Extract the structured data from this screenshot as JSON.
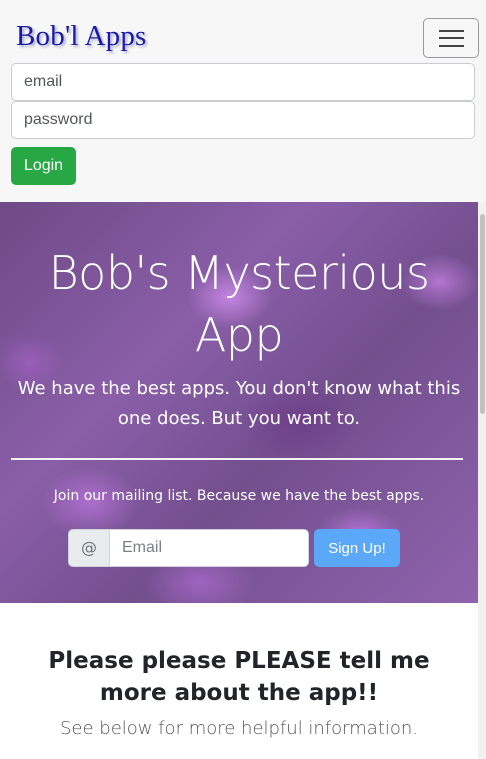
{
  "navbar": {
    "brand": "Bob'l Apps",
    "toggler_icon": "hamburger-menu-icon",
    "email_placeholder": "email",
    "password_placeholder": "password",
    "login_label": "Login",
    "login_color": "#28a745"
  },
  "hero": {
    "title": "Bob's Mysterious App",
    "lead": "We have the best apps. You don't know what this one does. But you want to.",
    "mailing_text": "Join our mailing list. Because we have the best apps.",
    "at_symbol": "@",
    "email_placeholder": "Email",
    "signup_label": "Sign Up!",
    "signup_color": "#5aa8f7",
    "background_color": "#7a5296"
  },
  "info": {
    "title": "Please please PLEASE tell me more about the app!!",
    "subtitle": "See below for more helpful information."
  }
}
